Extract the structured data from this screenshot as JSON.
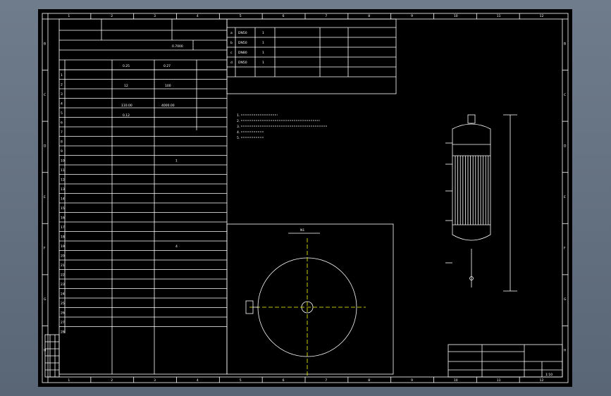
{
  "frame": {
    "column_numbers": [
      "1",
      "2",
      "3",
      "4",
      "5",
      "6",
      "7",
      "8",
      "9",
      "10",
      "11",
      "12"
    ],
    "row_letters": [
      "B",
      "C",
      "D",
      "E",
      "F",
      "G",
      "H"
    ]
  },
  "header": {
    "design_pressure_label": "0.25",
    "design_pressure_value": "0.27",
    "design_temp_label": "12",
    "design_temp_value": "100",
    "value_a": "110.00",
    "value_b": "4000.00",
    "value_c": "0.12",
    "value_d": "0.7000"
  },
  "nozzle_table": {
    "rows": [
      {
        "id": "a",
        "size": "DN50",
        "qty": "1"
      },
      {
        "id": "b",
        "size": "DN50",
        "qty": "1"
      },
      {
        "id": "c",
        "size": "DN80",
        "qty": "1"
      },
      {
        "id": "d",
        "size": "DN50",
        "qty": "1"
      }
    ]
  },
  "tech_table": {
    "row_numbers": [
      "1",
      "2",
      "3",
      "4",
      "5",
      "6",
      "7",
      "8",
      "9",
      "10",
      "11",
      "12",
      "13",
      "14",
      "15",
      "16",
      "17",
      "18",
      "19",
      "20",
      "21",
      "22",
      "23",
      "24",
      "25",
      "26",
      "27",
      "28"
    ],
    "values": [
      "",
      "",
      "",
      "",
      "",
      "",
      "",
      "",
      "",
      "1",
      "",
      "",
      "",
      "",
      "",
      "",
      "",
      "",
      "4",
      "",
      "",
      "",
      "",
      "",
      "",
      "",
      "",
      ""
    ]
  },
  "notes": {
    "lines": [
      "1.",
      "2.",
      "3.",
      "4.",
      "5."
    ]
  },
  "title_block": {
    "drawing_no": "",
    "scale": "1:10"
  },
  "annotations": {
    "nozzle_label": "N1"
  }
}
